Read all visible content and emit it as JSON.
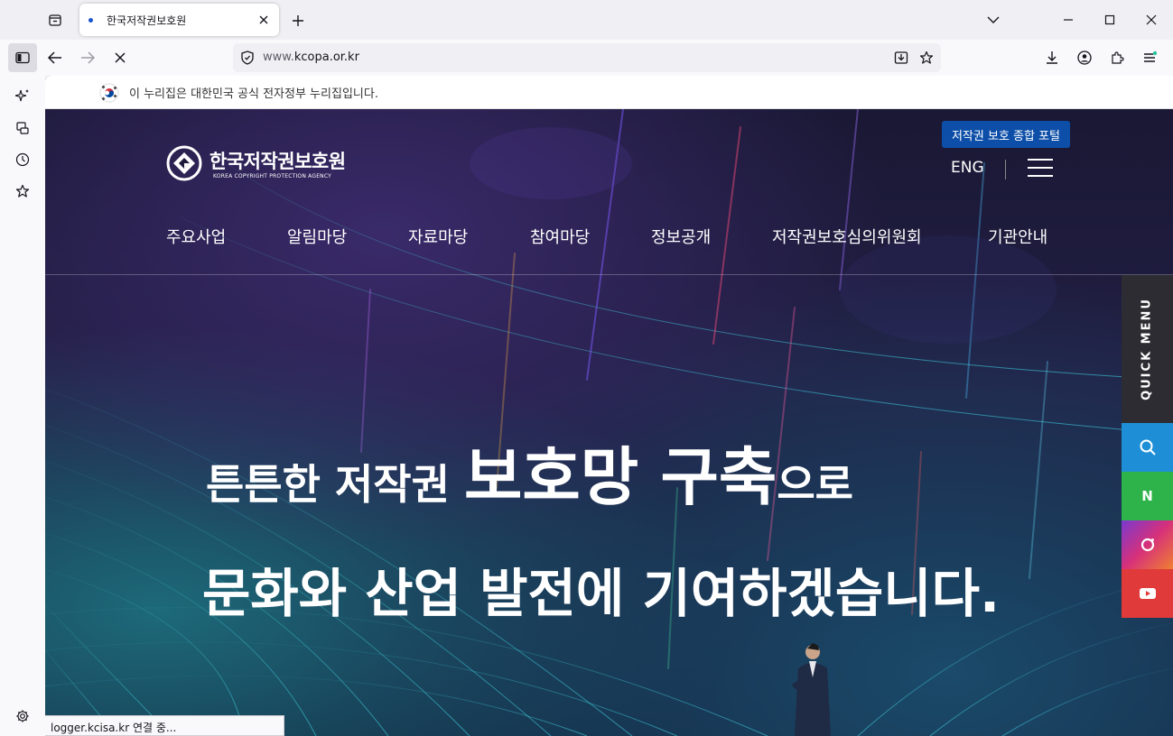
{
  "browser": {
    "tab": {
      "title": "한국저작권보호원"
    },
    "url": {
      "prefix": "www.",
      "domain": "kcopa.or.kr"
    },
    "status_text": "logger.kcisa.kr 연결 중..."
  },
  "gov_banner": {
    "text": "이 누리집은 대한민국 공식 전자정부 누리집입니다."
  },
  "header": {
    "logo_ko": "한국저작권보호원",
    "logo_en": "KOREA COPYRIGHT PROTECTION AGENCY",
    "portal_button": "저작권 보호 종합 포털",
    "lang": "ENG"
  },
  "gnb": [
    "주요사업",
    "알림마당",
    "자료마당",
    "참여마당",
    "정보공개",
    "저작권보호심의위원회",
    "기관안내"
  ],
  "hero": {
    "line1_a": "튼튼한 저작권 ",
    "line1_b": "보호망 구축",
    "line1_c": "으로",
    "line2": "문화와 산업 발전에 기여하겠습니다."
  },
  "quick_menu": {
    "label": "QUICK MENU",
    "items": [
      {
        "name": "search",
        "color": "#1e8fd6"
      },
      {
        "name": "naver-blog",
        "color": "#2db34a",
        "glyph": "N"
      },
      {
        "name": "instagram",
        "color": "#c7358a"
      },
      {
        "name": "youtube",
        "color": "#e03a3a"
      }
    ]
  }
}
